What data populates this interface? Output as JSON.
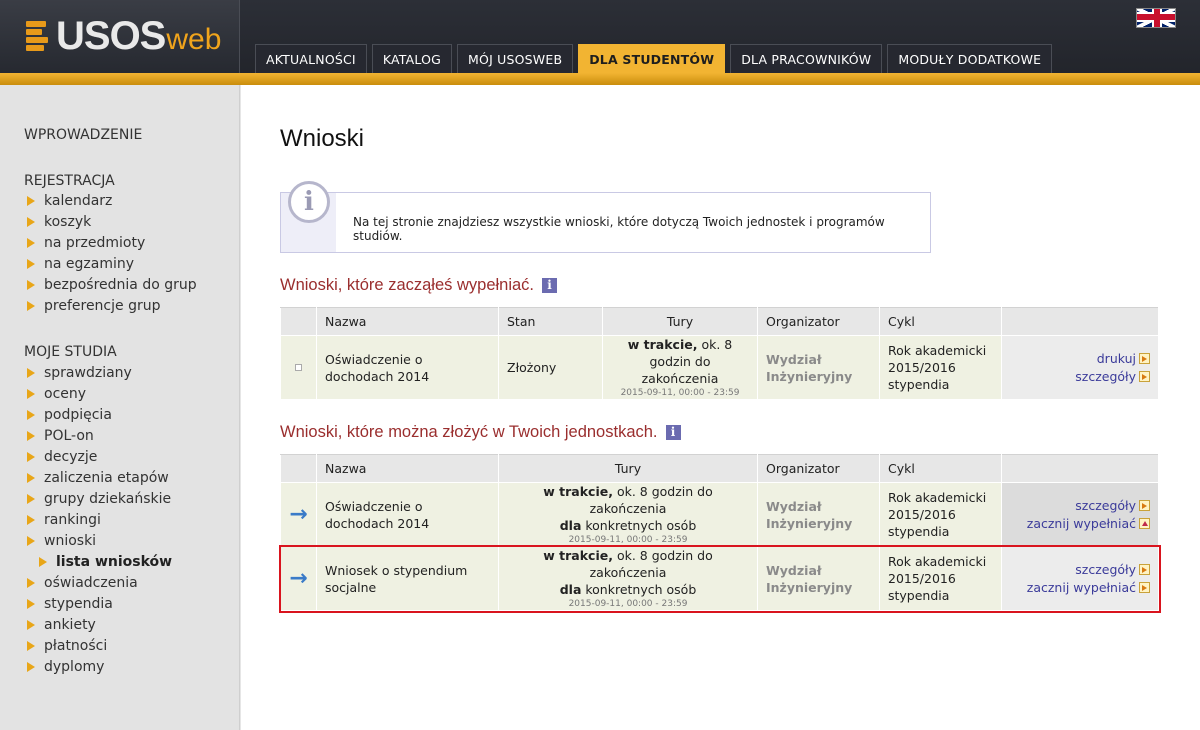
{
  "logo": {
    "usos": "USOS",
    "web": "web"
  },
  "nav": {
    "tabs": [
      {
        "label": "AKTUALNOŚCI"
      },
      {
        "label": "KATALOG"
      },
      {
        "label": "MÓJ USOSWEB"
      },
      {
        "label": "DLA STUDENTÓW"
      },
      {
        "label": "DLA PRACOWNIKÓW"
      },
      {
        "label": "MODUŁY DODATKOWE"
      }
    ],
    "active": "DLA STUDENTÓW"
  },
  "sidebar": {
    "intro": "WPROWADZENIE",
    "registration": {
      "title": "REJESTRACJA",
      "items": [
        "kalendarz",
        "koszyk",
        "na przedmioty",
        "na egzaminy",
        "bezpośrednia do grup",
        "preferencje grup"
      ]
    },
    "studies": {
      "title": "MOJE STUDIA",
      "items": [
        "sprawdziany",
        "oceny",
        "podpięcia",
        "POL-on",
        "decyzje",
        "zaliczenia etapów",
        "grupy dziekańskie",
        "rankingi",
        "wnioski"
      ],
      "sub_item": "lista wniosków",
      "items_after": [
        "oświadczenia",
        "stypendia",
        "ankiety",
        "płatności",
        "dyplomy"
      ]
    }
  },
  "main": {
    "title": "Wnioski",
    "info_text": "Na tej stronie znajdziesz wszystkie wnioski, które dotyczą Twoich jednostek i programów studiów.",
    "started": {
      "heading": "Wnioski, które zacząłeś wypełniać.",
      "headers": {
        "name": "Nazwa",
        "state": "Stan",
        "rounds": "Tury",
        "organizer": "Organizator",
        "cycle": "Cykl"
      },
      "row": {
        "name": "Oświadczenie o dochodach 2014",
        "state": "Złożony",
        "rounds_bold": "w trakcie,",
        "rounds_text": " ok. 8 godzin do zakończenia",
        "rounds_date": "2015-09-11, 00:00 - 23:59",
        "organizer": "Wydział Inżynieryjny",
        "cycle": "Rok akademicki 2015/2016 stypendia",
        "actions": [
          "drukuj",
          "szczegóły"
        ]
      }
    },
    "available": {
      "heading": "Wnioski, które można złożyć w Twoich jednostkach.",
      "headers": {
        "name": "Nazwa",
        "rounds": "Tury",
        "organizer": "Organizator",
        "cycle": "Cykl"
      },
      "rows": [
        {
          "name": "Oświadczenie o dochodach 2014",
          "rounds_bold": "w trakcie,",
          "rounds_text": " ok. 8 godzin do zakończenia",
          "rounds_bold2": "dla",
          "rounds_text2": " konkretnych osób",
          "rounds_date": "2015-09-11, 00:00 - 23:59",
          "organizer": "Wydział Inżynieryjny",
          "cycle": "Rok akademicki 2015/2016 stypendia",
          "actions": [
            "szczegóły",
            "zacznij wypełniać"
          ]
        },
        {
          "name": "Wniosek o stypendium socjalne",
          "rounds_bold": "w trakcie,",
          "rounds_text": " ok. 8 godzin do zakończenia",
          "rounds_bold2": "dla",
          "rounds_text2": " konkretnych osób",
          "rounds_date": "2015-09-11, 00:00 - 23:59",
          "organizer": "Wydział Inżynieryjny",
          "cycle": "Rok akademicki 2015/2016 stypendia",
          "actions": [
            "szczegóły",
            "zacznij wypełniać"
          ]
        }
      ]
    }
  },
  "colors": {
    "accent": "#f2b432",
    "heading": "#9a2e2e",
    "link": "#3b3b9a",
    "highlight_outline": "#d9141e"
  }
}
